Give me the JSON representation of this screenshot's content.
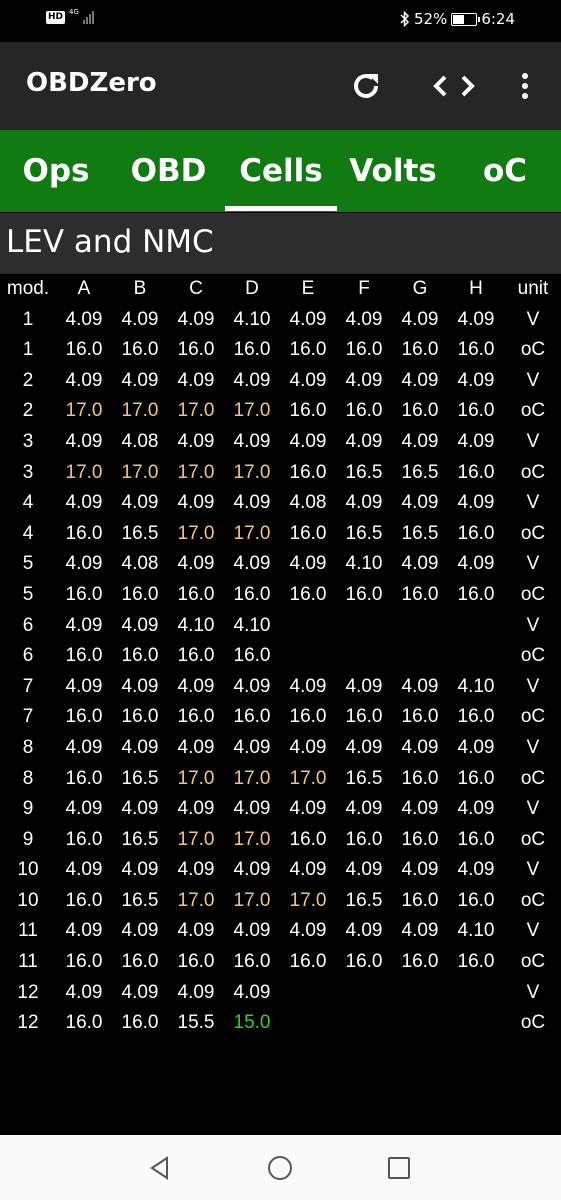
{
  "status": {
    "network_badge": "HD",
    "network_type": "4G",
    "bluetooth_icon": "bluetooth-icon",
    "battery_percent": "52%",
    "battery_level": 0.52,
    "time": "6:24"
  },
  "appbar": {
    "title": "OBDZero",
    "actions": [
      "refresh-icon",
      "code-icon",
      "more-vert-icon"
    ]
  },
  "tabs": [
    {
      "label": "Ops",
      "selected": false
    },
    {
      "label": "OBD",
      "selected": false
    },
    {
      "label": "Cells",
      "selected": true
    },
    {
      "label": "Volts",
      "selected": false
    },
    {
      "label": "oC",
      "selected": false
    }
  ],
  "section": {
    "title": "LEV and NMC"
  },
  "colors": {
    "tab_bar": "#127a12",
    "app_bar": "#262626",
    "highlight_warm": "#f0c48a",
    "highlight_cool": "#2fd12f"
  },
  "table": {
    "headers": [
      "mod.",
      "A",
      "B",
      "C",
      "D",
      "E",
      "F",
      "G",
      "H",
      "unit"
    ],
    "rows": [
      {
        "mod": "1",
        "cells": [
          "4.09",
          "4.09",
          "4.09",
          "4.10",
          "4.09",
          "4.09",
          "4.09",
          "4.09"
        ],
        "unit": "V"
      },
      {
        "mod": "1",
        "cells": [
          "16.0",
          "16.0",
          "16.0",
          "16.0",
          "16.0",
          "16.0",
          "16.0",
          "16.0"
        ],
        "unit": "oC"
      },
      {
        "mod": "2",
        "cells": [
          "4.09",
          "4.09",
          "4.09",
          "4.09",
          "4.09",
          "4.09",
          "4.09",
          "4.09"
        ],
        "unit": "V"
      },
      {
        "mod": "2",
        "cells": [
          "17.0",
          "17.0",
          "17.0",
          "17.0",
          "16.0",
          "16.0",
          "16.0",
          "16.0"
        ],
        "unit": "oC",
        "warm": [
          0,
          1,
          2,
          3
        ]
      },
      {
        "mod": "3",
        "cells": [
          "4.09",
          "4.08",
          "4.09",
          "4.09",
          "4.09",
          "4.09",
          "4.09",
          "4.09"
        ],
        "unit": "V"
      },
      {
        "mod": "3",
        "cells": [
          "17.0",
          "17.0",
          "17.0",
          "17.0",
          "16.0",
          "16.5",
          "16.5",
          "16.0"
        ],
        "unit": "oC",
        "warm": [
          0,
          1,
          2,
          3
        ]
      },
      {
        "mod": "4",
        "cells": [
          "4.09",
          "4.09",
          "4.09",
          "4.09",
          "4.08",
          "4.09",
          "4.09",
          "4.09"
        ],
        "unit": "V"
      },
      {
        "mod": "4",
        "cells": [
          "16.0",
          "16.5",
          "17.0",
          "17.0",
          "16.0",
          "16.5",
          "16.5",
          "16.0"
        ],
        "unit": "oC",
        "warm": [
          2,
          3
        ]
      },
      {
        "mod": "5",
        "cells": [
          "4.09",
          "4.08",
          "4.09",
          "4.09",
          "4.09",
          "4.10",
          "4.09",
          "4.09"
        ],
        "unit": "V"
      },
      {
        "mod": "5",
        "cells": [
          "16.0",
          "16.0",
          "16.0",
          "16.0",
          "16.0",
          "16.0",
          "16.0",
          "16.0"
        ],
        "unit": "oC"
      },
      {
        "mod": "6",
        "cells": [
          "4.09",
          "4.09",
          "4.10",
          "4.10",
          "",
          "",
          "",
          ""
        ],
        "unit": "V"
      },
      {
        "mod": "6",
        "cells": [
          "16.0",
          "16.0",
          "16.0",
          "16.0",
          "",
          "",
          "",
          ""
        ],
        "unit": "oC"
      },
      {
        "mod": "7",
        "cells": [
          "4.09",
          "4.09",
          "4.09",
          "4.09",
          "4.09",
          "4.09",
          "4.09",
          "4.10"
        ],
        "unit": "V"
      },
      {
        "mod": "7",
        "cells": [
          "16.0",
          "16.0",
          "16.0",
          "16.0",
          "16.0",
          "16.0",
          "16.0",
          "16.0"
        ],
        "unit": "oC"
      },
      {
        "mod": "8",
        "cells": [
          "4.09",
          "4.09",
          "4.09",
          "4.09",
          "4.09",
          "4.09",
          "4.09",
          "4.09"
        ],
        "unit": "V"
      },
      {
        "mod": "8",
        "cells": [
          "16.0",
          "16.5",
          "17.0",
          "17.0",
          "17.0",
          "16.5",
          "16.0",
          "16.0"
        ],
        "unit": "oC",
        "warm": [
          2,
          3,
          4
        ]
      },
      {
        "mod": "9",
        "cells": [
          "4.09",
          "4.09",
          "4.09",
          "4.09",
          "4.09",
          "4.09",
          "4.09",
          "4.09"
        ],
        "unit": "V"
      },
      {
        "mod": "9",
        "cells": [
          "16.0",
          "16.5",
          "17.0",
          "17.0",
          "16.0",
          "16.0",
          "16.0",
          "16.0"
        ],
        "unit": "oC",
        "warm": [
          2,
          3
        ]
      },
      {
        "mod": "10",
        "cells": [
          "4.09",
          "4.09",
          "4.09",
          "4.09",
          "4.09",
          "4.09",
          "4.09",
          "4.09"
        ],
        "unit": "V"
      },
      {
        "mod": "10",
        "cells": [
          "16.0",
          "16.5",
          "17.0",
          "17.0",
          "17.0",
          "16.5",
          "16.0",
          "16.0"
        ],
        "unit": "oC",
        "warm": [
          2,
          3,
          4
        ]
      },
      {
        "mod": "11",
        "cells": [
          "4.09",
          "4.09",
          "4.09",
          "4.09",
          "4.09",
          "4.09",
          "4.09",
          "4.10"
        ],
        "unit": "V"
      },
      {
        "mod": "11",
        "cells": [
          "16.0",
          "16.0",
          "16.0",
          "16.0",
          "16.0",
          "16.0",
          "16.0",
          "16.0"
        ],
        "unit": "oC"
      },
      {
        "mod": "12",
        "cells": [
          "4.09",
          "4.09",
          "4.09",
          "4.09",
          "",
          "",
          "",
          ""
        ],
        "unit": "V"
      },
      {
        "mod": "12",
        "cells": [
          "16.0",
          "16.0",
          "15.5",
          "15.0",
          "",
          "",
          "",
          ""
        ],
        "unit": "oC",
        "cool": [
          3
        ]
      }
    ]
  },
  "navbar": {
    "buttons": [
      "back-icon",
      "home-icon",
      "recents-icon"
    ]
  }
}
